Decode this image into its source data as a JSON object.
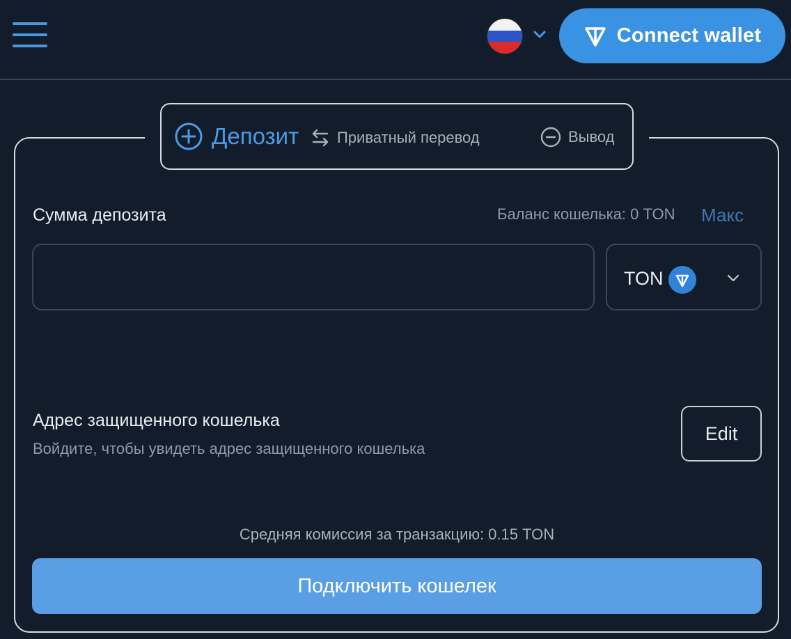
{
  "header": {
    "menu_icon": "hamburger-menu-icon",
    "language": {
      "flag": "russia-flag",
      "chevron": "chevron-down-icon"
    },
    "connect_button": {
      "icon": "ton-logo-icon",
      "label": "Connect wallet"
    }
  },
  "tabs": {
    "deposit": {
      "icon": "plus-circle-icon",
      "label": "Депозит"
    },
    "private_transfer": {
      "icon": "swap-arrows-icon",
      "label": "Приватный перевод"
    },
    "withdraw": {
      "icon": "minus-circle-icon",
      "label": "Вывод"
    },
    "active": "deposit"
  },
  "deposit_form": {
    "amount_label": "Сумма депозита",
    "balance_label": "Баланс кошелька: 0 TON",
    "max_label": "Макс",
    "amount_value": "",
    "token": {
      "symbol": "TON",
      "icon": "ton-coin-icon",
      "chevron": "chevron-down-icon"
    }
  },
  "address_section": {
    "title": "Адрес защищенного кошелька",
    "hint": "Войдите, чтобы увидеть адрес защищенного кошелька",
    "edit_label": "Edit"
  },
  "fee_label": "Средняя комиссия за транзакцию: 0.15 TON",
  "submit_label": "Подключить кошелек",
  "colors": {
    "background": "#131c2a",
    "accent": "#3a92e3",
    "submit": "#5a9fe3",
    "muted_text": "#8f9aa8"
  }
}
